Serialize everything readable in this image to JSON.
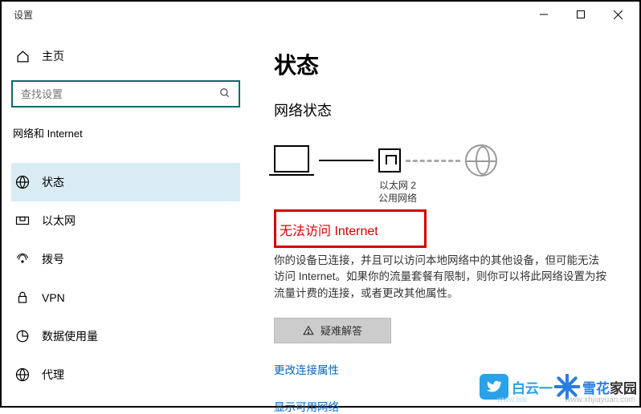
{
  "window_title": "设置",
  "sidebar": {
    "home_label": "主页",
    "search_placeholder": "查找设置",
    "category": "网络和 Internet",
    "items": [
      {
        "label": "状态",
        "icon": "status-icon"
      },
      {
        "label": "以太网",
        "icon": "ethernet-icon"
      },
      {
        "label": "拨号",
        "icon": "dialup-icon"
      },
      {
        "label": "VPN",
        "icon": "vpn-icon"
      },
      {
        "label": "数据使用量",
        "icon": "data-usage-icon"
      },
      {
        "label": "代理",
        "icon": "proxy-icon"
      }
    ]
  },
  "main": {
    "title": "状态",
    "subtitle": "网络状态",
    "eth_name": "以太网 2",
    "eth_profile": "公用网络",
    "error_title": "无法访问 Internet",
    "description": "你的设备已连接，并且可以访问本地网络中的其他设备，但可能无法访问 Internet。如果你的流量套餐有限制，则你可以将此网络设置为按流量计费的连接，或者更改其他属性。",
    "troubleshoot_label": "疑难解答",
    "link_change_props": "更改连接属性",
    "link_show_networks": "显示可用网络"
  },
  "watermarks": {
    "left_text": "白云一",
    "left_url": "www.bai",
    "right_text_1": "雪花",
    "right_text_2": "家园",
    "right_url": "www.xhjiayuan.com"
  }
}
